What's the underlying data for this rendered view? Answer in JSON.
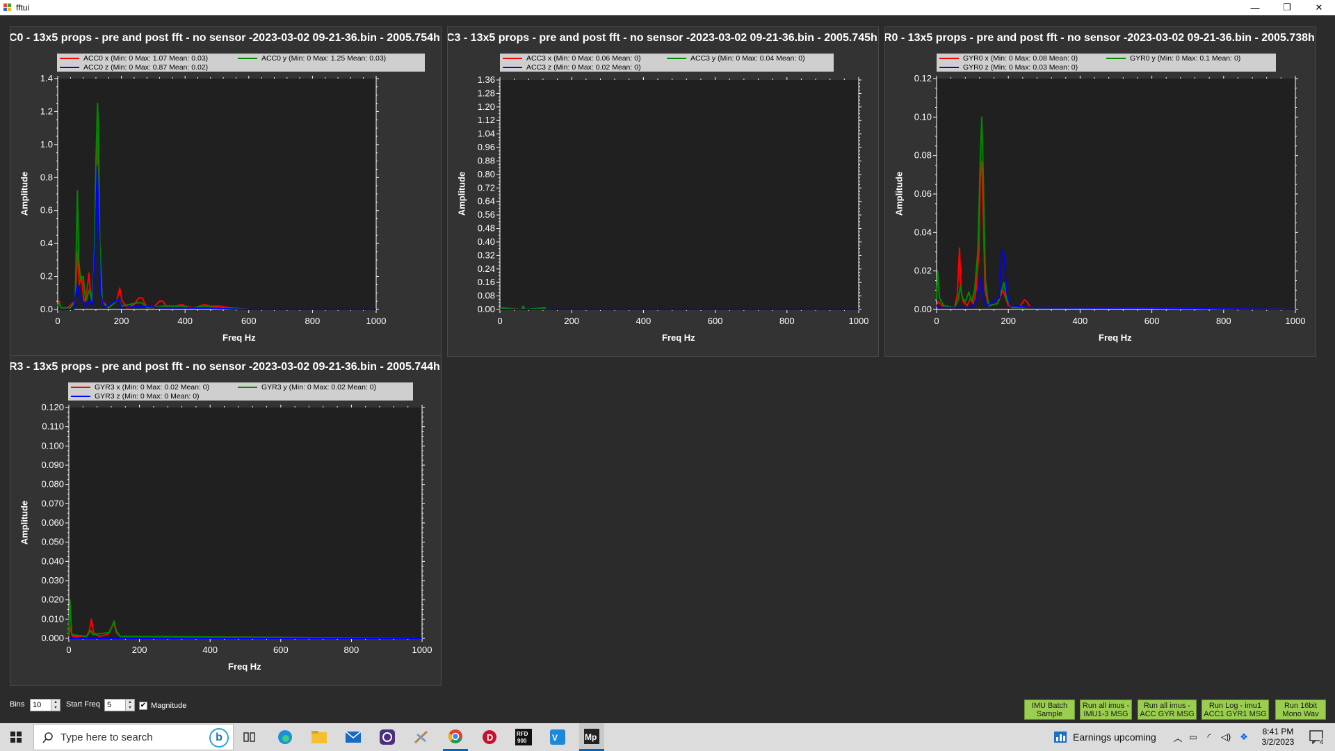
{
  "window": {
    "title": "fftui",
    "controls": [
      "—",
      "❐",
      "✕"
    ]
  },
  "panels": [
    {
      "id": "acc0",
      "title": "C0 - 13x5 props - pre and post fft - no sensor -2023-03-02 09-21-36.bin - 2005.754h",
      "legend": [
        "ACC0 x (Min: 0 Max: 1.07 Mean: 0.03)",
        "ACC0 y (Min: 0 Max: 1.25 Mean: 0.03)",
        "ACC0 z (Min: 0 Max: 0.87 Mean: 0.02)"
      ],
      "ylabel": "Amplitude",
      "xlabel": "Freq Hz"
    },
    {
      "id": "acc3",
      "title": "C3 - 13x5 props - pre and post fft - no sensor -2023-03-02 09-21-36.bin - 2005.745h",
      "legend": [
        "ACC3 x (Min: 0 Max: 0.06 Mean: 0)",
        "ACC3 y (Min: 0 Max: 0.04 Mean: 0)",
        "ACC3 z (Min: 0 Max: 0.02 Mean: 0)"
      ],
      "ylabel": "Amplitude",
      "xlabel": "Freq Hz"
    },
    {
      "id": "gyr0",
      "title": "R0 - 13x5 props - pre and post fft - no sensor -2023-03-02 09-21-36.bin - 2005.738h",
      "legend": [
        "GYR0 x (Min: 0 Max: 0.08 Mean: 0)",
        "GYR0 y (Min: 0 Max: 0.1 Mean: 0)",
        "GYR0 z (Min: 0 Max: 0.03 Mean: 0)"
      ],
      "ylabel": "Amplitude",
      "xlabel": "Freq Hz"
    },
    {
      "id": "gyr3",
      "title": "R3 - 13x5 props - pre and post fft - no sensor -2023-03-02 09-21-36.bin - 2005.744h",
      "legend": [
        "GYR3 x (Min: 0 Max: 0.02 Mean: 0)",
        "GYR3 y (Min: 0 Max: 0.02 Mean: 0)",
        "GYR3 z (Min: 0 Max: 0 Mean: 0)"
      ],
      "ylabel": "Amplitude",
      "xlabel": "Freq Hz"
    }
  ],
  "chart_data": [
    {
      "type": "line",
      "xlabel": "Freq Hz",
      "ylabel": "Amplitude",
      "xlim": [
        0,
        1000
      ],
      "ylim": [
        0,
        1.4
      ],
      "xticks": [
        "0",
        "200",
        "400",
        "600",
        "800",
        "1000"
      ],
      "yticks": [
        "0.0",
        "0.2",
        "0.4",
        "0.6",
        "0.8",
        "1.0",
        "1.2",
        "1.4"
      ],
      "legend_position": "top",
      "series": [
        {
          "name": "ACC0 x",
          "color": "#ff0000",
          "points": [
            [
              0,
              0.02
            ],
            [
              5,
              0.05
            ],
            [
              10,
              0.01
            ],
            [
              30,
              0.01
            ],
            [
              55,
              0.05
            ],
            [
              62,
              0.35
            ],
            [
              68,
              0.15
            ],
            [
              75,
              0.2
            ],
            [
              82,
              0.05
            ],
            [
              90,
              0.08
            ],
            [
              98,
              0.22
            ],
            [
              104,
              0.08
            ],
            [
              112,
              0.12
            ],
            [
              118,
              0.5
            ],
            [
              122,
              0.95
            ],
            [
              125,
              1.07
            ],
            [
              128,
              0.75
            ],
            [
              133,
              0.3
            ],
            [
              140,
              0.05
            ],
            [
              160,
              0.01
            ],
            [
              185,
              0.05
            ],
            [
              195,
              0.13
            ],
            [
              202,
              0.05
            ],
            [
              220,
              0.01
            ],
            [
              240,
              0.03
            ],
            [
              255,
              0.07
            ],
            [
              265,
              0.07
            ],
            [
              278,
              0.02
            ],
            [
              300,
              0.01
            ],
            [
              320,
              0.05
            ],
            [
              330,
              0.05
            ],
            [
              345,
              0.01
            ],
            [
              370,
              0.02
            ],
            [
              390,
              0.03
            ],
            [
              400,
              0.02
            ],
            [
              430,
              0.01
            ],
            [
              460,
              0.03
            ],
            [
              480,
              0.02
            ],
            [
              510,
              0.02
            ],
            [
              540,
              0.01
            ],
            [
              600,
              0
            ],
            [
              1000,
              0
            ]
          ]
        },
        {
          "name": "ACC0 y",
          "color": "#008a00",
          "points": [
            [
              0,
              0.02
            ],
            [
              5,
              0.04
            ],
            [
              10,
              0.01
            ],
            [
              40,
              0.01
            ],
            [
              55,
              0.05
            ],
            [
              62,
              0.72
            ],
            [
              66,
              0.3
            ],
            [
              72,
              0.18
            ],
            [
              80,
              0.2
            ],
            [
              88,
              0.05
            ],
            [
              100,
              0.12
            ],
            [
              108,
              0.05
            ],
            [
              115,
              0.3
            ],
            [
              120,
              0.9
            ],
            [
              125,
              1.25
            ],
            [
              128,
              1.1
            ],
            [
              132,
              0.4
            ],
            [
              140,
              0.04
            ],
            [
              160,
              0.01
            ],
            [
              190,
              0.06
            ],
            [
              200,
              0.02
            ],
            [
              250,
              0.04
            ],
            [
              265,
              0.04
            ],
            [
              280,
              0.01
            ],
            [
              330,
              0.02
            ],
            [
              390,
              0.02
            ],
            [
              420,
              0.01
            ],
            [
              460,
              0.02
            ],
            [
              500,
              0.01
            ],
            [
              600,
              0
            ],
            [
              1000,
              0
            ]
          ]
        },
        {
          "name": "ACC0 z",
          "color": "#0000ff",
          "points": [
            [
              0,
              0
            ],
            [
              50,
              0
            ],
            [
              62,
              0.15
            ],
            [
              68,
              0.08
            ],
            [
              90,
              0.02
            ],
            [
              100,
              0.05
            ],
            [
              110,
              0.03
            ],
            [
              118,
              0.4
            ],
            [
              124,
              0.87
            ],
            [
              128,
              0.6
            ],
            [
              134,
              0.1
            ],
            [
              145,
              0.01
            ],
            [
              190,
              0.06
            ],
            [
              200,
              0.01
            ],
            [
              260,
              0.02
            ],
            [
              330,
              0.01
            ],
            [
              400,
              0.01
            ],
            [
              600,
              0
            ],
            [
              1000,
              0
            ]
          ]
        }
      ]
    },
    {
      "type": "line",
      "xlabel": "Freq Hz",
      "ylabel": "Amplitude",
      "xlim": [
        0,
        1000
      ],
      "ylim": [
        0,
        1.36
      ],
      "xticks": [
        "0",
        "200",
        "400",
        "600",
        "800",
        "1000"
      ],
      "yticks": [
        "0.00",
        "0.08",
        "0.16",
        "0.24",
        "0.32",
        "0.40",
        "0.48",
        "0.56",
        "0.64",
        "0.72",
        "0.80",
        "0.88",
        "0.96",
        "1.04",
        "1.12",
        "1.20",
        "1.28",
        "1.36"
      ],
      "legend_position": "top",
      "series": [
        {
          "name": "ACC3 x",
          "color": "#ff0000",
          "points": [
            [
              0,
              0
            ],
            [
              5,
              0.01
            ],
            [
              60,
              0
            ],
            [
              65,
              0.01
            ],
            [
              70,
              0
            ],
            [
              125,
              0.006
            ],
            [
              130,
              0
            ],
            [
              1000,
              0
            ]
          ]
        },
        {
          "name": "ACC3 y",
          "color": "#008a00",
          "points": [
            [
              0,
              0
            ],
            [
              5,
              0.006
            ],
            [
              60,
              0
            ],
            [
              65,
              0.02
            ],
            [
              70,
              0
            ],
            [
              125,
              0.01
            ],
            [
              130,
              0
            ],
            [
              1000,
              0
            ]
          ]
        },
        {
          "name": "ACC3 z",
          "color": "#0000ff",
          "points": [
            [
              0,
              0
            ],
            [
              1000,
              0
            ]
          ]
        }
      ]
    },
    {
      "type": "line",
      "xlabel": "Freq Hz",
      "ylabel": "Amplitude",
      "xlim": [
        0,
        1000
      ],
      "ylim": [
        0,
        0.12
      ],
      "xticks": [
        "0",
        "200",
        "400",
        "600",
        "800",
        "1000"
      ],
      "yticks": [
        "0.00",
        "0.02",
        "0.04",
        "0.06",
        "0.08",
        "0.10",
        "0.12"
      ],
      "legend_position": "top",
      "series": [
        {
          "name": "GYR0 x",
          "color": "#ff0000",
          "points": [
            [
              0,
              0.002
            ],
            [
              5,
              0.004
            ],
            [
              20,
              0.001
            ],
            [
              50,
              0.001
            ],
            [
              58,
              0.008
            ],
            [
              64,
              0.032
            ],
            [
              68,
              0.01
            ],
            [
              74,
              0.004
            ],
            [
              85,
              0.002
            ],
            [
              95,
              0.006
            ],
            [
              102,
              0.003
            ],
            [
              110,
              0.01
            ],
            [
              118,
              0.03
            ],
            [
              122,
              0.07
            ],
            [
              126,
              0.077
            ],
            [
              130,
              0.05
            ],
            [
              135,
              0.01
            ],
            [
              145,
              0.002
            ],
            [
              170,
              0.003
            ],
            [
              185,
              0.01
            ],
            [
              192,
              0.006
            ],
            [
              200,
              0.002
            ],
            [
              230,
              0.001
            ],
            [
              245,
              0.005
            ],
            [
              252,
              0.004
            ],
            [
              260,
              0.001
            ],
            [
              330,
              0.001
            ],
            [
              1000,
              0
            ]
          ]
        },
        {
          "name": "GYR0 y",
          "color": "#008a00",
          "points": [
            [
              0,
              0.005
            ],
            [
              3,
              0.02
            ],
            [
              8,
              0.006
            ],
            [
              20,
              0.002
            ],
            [
              50,
              0.001
            ],
            [
              60,
              0.005
            ],
            [
              66,
              0.012
            ],
            [
              72,
              0.006
            ],
            [
              80,
              0.004
            ],
            [
              90,
              0.009
            ],
            [
              98,
              0.004
            ],
            [
              106,
              0.01
            ],
            [
              115,
              0.03
            ],
            [
              122,
              0.08
            ],
            [
              126,
              0.1
            ],
            [
              130,
              0.07
            ],
            [
              136,
              0.015
            ],
            [
              145,
              0.002
            ],
            [
              170,
              0.003
            ],
            [
              188,
              0.014
            ],
            [
              195,
              0.005
            ],
            [
              210,
              0.001
            ],
            [
              1000,
              0
            ]
          ]
        },
        {
          "name": "GYR0 z",
          "color": "#0000ff",
          "points": [
            [
              0,
              0.002
            ],
            [
              5,
              0.001
            ],
            [
              100,
              0.001
            ],
            [
              112,
              0.005
            ],
            [
              118,
              0.012
            ],
            [
              124,
              0.016
            ],
            [
              130,
              0.006
            ],
            [
              140,
              0.002
            ],
            [
              175,
              0.006
            ],
            [
              182,
              0.031
            ],
            [
              188,
              0.028
            ],
            [
              195,
              0.01
            ],
            [
              205,
              0.002
            ],
            [
              260,
              0.001
            ],
            [
              1000,
              0
            ]
          ]
        }
      ]
    },
    {
      "type": "line",
      "xlabel": "Freq Hz",
      "ylabel": "Amplitude",
      "xlim": [
        0,
        1000
      ],
      "ylim": [
        0,
        0.12
      ],
      "xticks": [
        "0",
        "200",
        "400",
        "600",
        "800",
        "1000"
      ],
      "yticks": [
        "0.000",
        "0.010",
        "0.020",
        "0.030",
        "0.040",
        "0.050",
        "0.060",
        "0.070",
        "0.080",
        "0.090",
        "0.100",
        "0.110",
        "0.120"
      ],
      "legend_position": "top",
      "series": [
        {
          "name": "GYR3 x",
          "color": "#ff0000",
          "points": [
            [
              0,
              0.001
            ],
            [
              5,
              0.006
            ],
            [
              10,
              0.001
            ],
            [
              50,
              0.001
            ],
            [
              58,
              0.004
            ],
            [
              64,
              0.01
            ],
            [
              70,
              0.003
            ],
            [
              85,
              0.001
            ],
            [
              110,
              0.002
            ],
            [
              122,
              0.006
            ],
            [
              128,
              0.008
            ],
            [
              134,
              0.003
            ],
            [
              145,
              0.001
            ],
            [
              1000,
              0
            ]
          ]
        },
        {
          "name": "GYR3 y",
          "color": "#008a00",
          "points": [
            [
              0,
              0.002
            ],
            [
              3,
              0.02
            ],
            [
              8,
              0.002
            ],
            [
              50,
              0.001
            ],
            [
              62,
              0.004
            ],
            [
              68,
              0.002
            ],
            [
              115,
              0.003
            ],
            [
              124,
              0.007
            ],
            [
              128,
              0.009
            ],
            [
              134,
              0.004
            ],
            [
              145,
              0.001
            ],
            [
              1000,
              0
            ]
          ]
        },
        {
          "name": "GYR3 z",
          "color": "#0000ff",
          "points": [
            [
              0,
              0
            ],
            [
              1000,
              0
            ]
          ]
        }
      ]
    }
  ],
  "controls": {
    "bins_label": "Bins",
    "bins_value": "10",
    "startfreq_label": "Start Freq",
    "startfreq_value": "5",
    "magnitude_label": "Magnitude",
    "magnitude_checked": true
  },
  "buttons": [
    {
      "line1": "IMU Batch",
      "line2": "Sample"
    },
    {
      "line1": "Run all imus -",
      "line2": "IMU1-3 MSG"
    },
    {
      "line1": "Run all imus -",
      "line2": "ACC GYR MSG"
    },
    {
      "line1": "Run Log - imu1",
      "line2": "ACC1 GYR1 MSG"
    },
    {
      "line1": "Run 16bit",
      "line2": "Mono Wav"
    }
  ],
  "taskbar": {
    "search_placeholder": "Type here to search",
    "apps": [
      "bing-chat",
      "task-view",
      "edge",
      "file-explorer",
      "mail",
      "obs",
      "git-tool",
      "chrome",
      "davinci",
      "rfd900",
      "visual-studio-code",
      "mission-planner"
    ],
    "news": "Earnings upcoming",
    "time": "8:41 PM",
    "date": "3/2/2023",
    "notifications": "4"
  }
}
